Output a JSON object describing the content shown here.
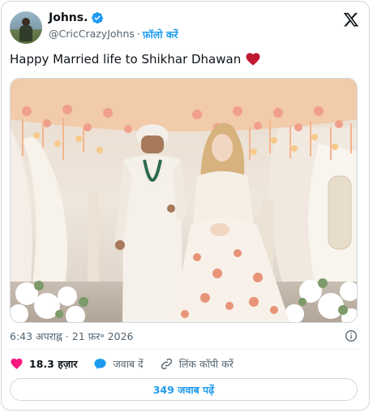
{
  "author": {
    "display_name": "Johns.",
    "handle": "@CricCrazyJohns",
    "separator": "·",
    "follow_label": "फ़ॉलो करें"
  },
  "tweet": {
    "text": "Happy Married life to Shikhar Dhawan",
    "timestamp": "6:43 अपराह्न · 21 फ़र॰ 2026"
  },
  "actions": {
    "likes_count": "18.3 हज़ार",
    "reply_label": "जवाब दें",
    "copy_link_label": "लिंक कॉपी करें",
    "read_replies_label": "349 जवाब पढ़ें"
  },
  "colors": {
    "accent": "#1d9bf0",
    "like": "#f91880",
    "heart_emoji": "#be1931"
  },
  "icons": [
    "verified-badge-icon",
    "x-logo-icon",
    "heart-emoji-icon",
    "info-icon",
    "like-heart-icon",
    "reply-bubble-icon",
    "link-icon"
  ]
}
